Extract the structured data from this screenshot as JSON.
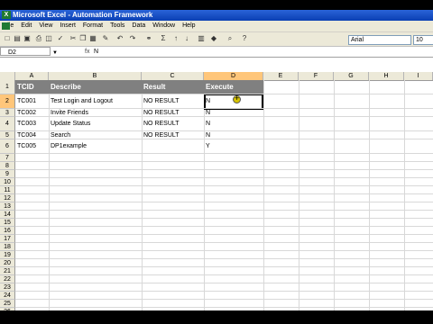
{
  "window": {
    "title": "Microsoft Excel - Automation Framework"
  },
  "menu": {
    "items": [
      "File",
      "Edit",
      "View",
      "Insert",
      "Format",
      "Tools",
      "Data",
      "Window",
      "Help"
    ]
  },
  "toolbar": {
    "font_name": "Arial",
    "font_size": "10"
  },
  "formula_bar": {
    "cell_ref": "D2",
    "fx_label": "fx",
    "value": "N"
  },
  "sheet": {
    "columns": [
      "A",
      "B",
      "C",
      "D",
      "E",
      "F",
      "G",
      "H",
      "I"
    ],
    "selected_column": "D",
    "selected_row": 2,
    "header_row": [
      "TCID",
      "Describe",
      "Result",
      "Execute"
    ],
    "rows": [
      [
        "TC001",
        "Test Login and Logout",
        "NO RESULT",
        "N"
      ],
      [
        "TC002",
        "Invite Friends",
        "NO RESULT",
        "N"
      ],
      [
        "TC003",
        "Update Status",
        "NO RESULT",
        "N"
      ],
      [
        "TC004",
        "Search",
        "NO RESULT",
        "N"
      ],
      [
        "TC005",
        "DP1example",
        "",
        "Y"
      ]
    ],
    "row_numbers": [
      "1",
      "2",
      "3",
      "4",
      "5",
      "6",
      "7",
      "8",
      "9",
      "10",
      "11",
      "12",
      "13",
      "14",
      "15",
      "16",
      "17",
      "18",
      "19",
      "20",
      "21",
      "22",
      "23",
      "24",
      "25",
      "26",
      "27",
      "28"
    ]
  },
  "colors": {
    "header_fill": "#808080",
    "selection_highlight": "#ffc67a",
    "titlebar": "#0a3fb3"
  }
}
